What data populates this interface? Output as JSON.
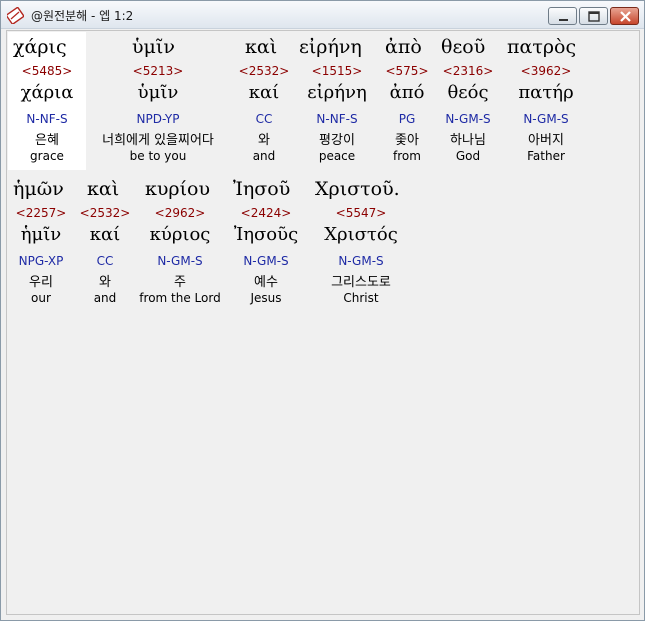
{
  "window": {
    "title": "@원전분해 - 엡 1:2",
    "buttons": {
      "minimize": "minimize",
      "maximize": "maximize",
      "close": "close"
    }
  },
  "colors": {
    "strong": "#8b0000",
    "parse": "#1e2aa5",
    "highlight": "#ffffff"
  },
  "rows": [
    {
      "words": [
        {
          "greek": "χάρις",
          "strong": "<5485>",
          "lemma": "χάρια",
          "parse": "N-NF-S",
          "korean": "은혜",
          "english": "grace"
        },
        {
          "greek": "ὑμῖν",
          "strong": "<5213>",
          "lemma": "ὑμῖν",
          "parse": "NPD-YP",
          "korean": "너희에게 있을찌어다",
          "english": "be to you"
        },
        {
          "greek": "καὶ",
          "strong": "<2532>",
          "lemma": "καί",
          "parse": "CC",
          "korean": "와",
          "english": "and"
        },
        {
          "greek": "εἰρήνη",
          "strong": "<1515>",
          "lemma": "εἰρήνη",
          "parse": "N-NF-S",
          "korean": "평강이",
          "english": "peace"
        },
        {
          "greek": "ἀπὸ",
          "strong": "<575>",
          "lemma": "ἀπό",
          "parse": "PG",
          "korean": "좇아",
          "english": "from"
        },
        {
          "greek": "θεοῦ",
          "strong": "<2316>",
          "lemma": "θεός",
          "parse": "N-GM-S",
          "korean": "하나님",
          "english": "God"
        },
        {
          "greek": "πατρὸς",
          "strong": "<3962>",
          "lemma": "πατήρ",
          "parse": "N-GM-S",
          "korean": "아버지",
          "english": "Father"
        }
      ]
    },
    {
      "words": [
        {
          "greek": "ἡμῶν",
          "strong": "<2257>",
          "lemma": "ἡμῖν",
          "parse": "NPG-XP",
          "korean": "우리",
          "english": "our"
        },
        {
          "greek": "καὶ",
          "strong": "<2532>",
          "lemma": "καί",
          "parse": "CC",
          "korean": "와",
          "english": "and"
        },
        {
          "greek": "κυρίου",
          "strong": "<2962>",
          "lemma": "κύριος",
          "parse": "N-GM-S",
          "korean": "주",
          "english": "from the Lord"
        },
        {
          "greek": "Ἰησοῦ",
          "strong": "<2424>",
          "lemma": "Ἰησοῦς",
          "parse": "N-GM-S",
          "korean": "예수",
          "english": "Jesus"
        },
        {
          "greek": "Χριστοῦ.",
          "strong": "<5547>",
          "lemma": "Χριστός",
          "parse": "N-GM-S",
          "korean": "그리스도로",
          "english": "Christ"
        }
      ]
    }
  ]
}
